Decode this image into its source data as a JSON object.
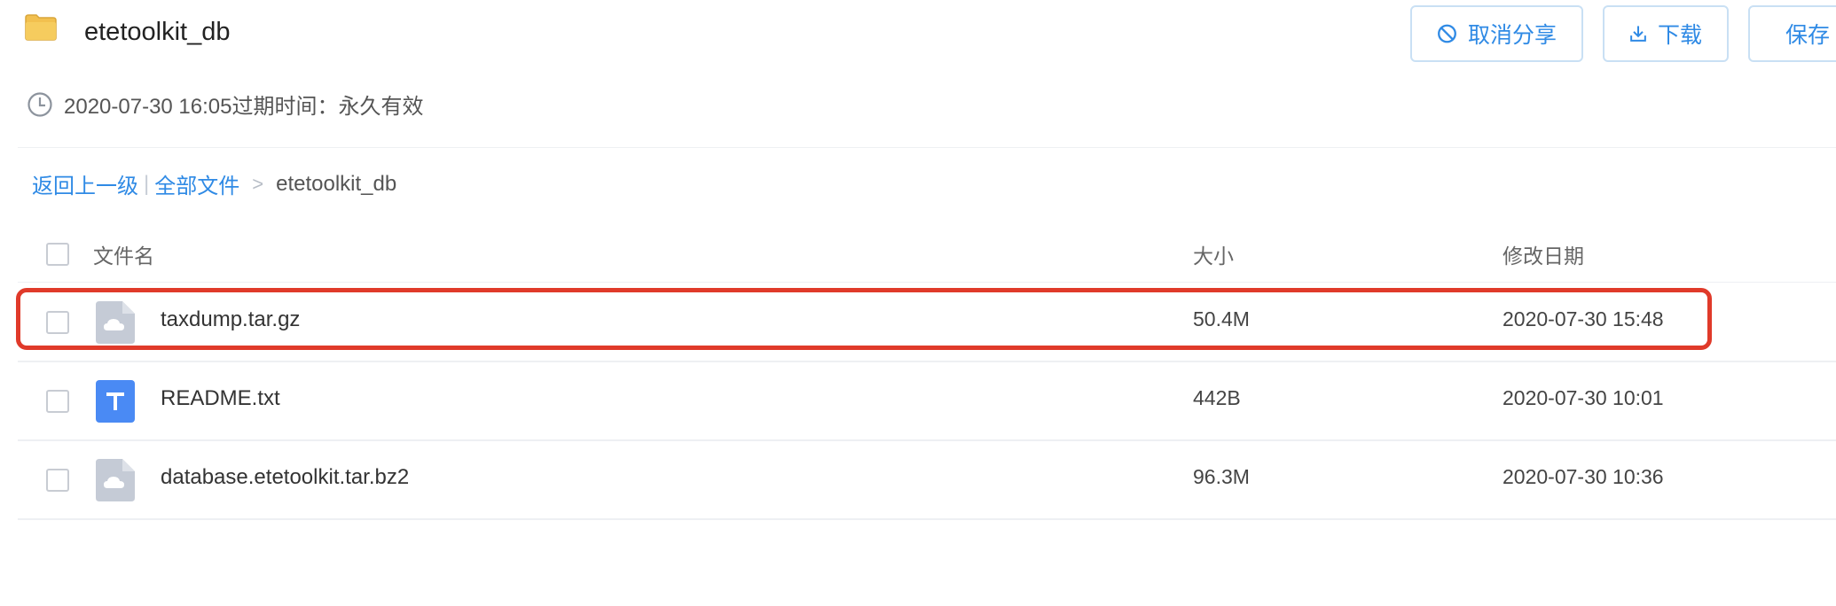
{
  "header": {
    "title": "etetoolkit_db",
    "folder_icon": "folder-icon"
  },
  "actions": {
    "cancel_share": "取消分享",
    "download": "下载",
    "save": "保存"
  },
  "meta": {
    "clock_icon": "clock-icon",
    "text": "2020-07-30 16:05过期时间：永久有效"
  },
  "breadcrumb": {
    "back": "返回上一级",
    "all_files": "全部文件",
    "separator": ">",
    "current": "etetoolkit_db"
  },
  "table": {
    "columns": {
      "name": "文件名",
      "size": "大小",
      "date": "修改日期"
    },
    "rows": [
      {
        "name": "taxdump.tar.gz",
        "size": "50.4M",
        "date": "2020-07-30 15:48",
        "icon": "cloud-file-icon",
        "highlighted": true
      },
      {
        "name": "README.txt",
        "size": "442B",
        "date": "2020-07-30 10:01",
        "icon": "text-file-icon"
      },
      {
        "name": "database.etetoolkit.tar.bz2",
        "size": "96.3M",
        "date": "2020-07-30 10:36",
        "icon": "cloud-file-icon"
      }
    ]
  },
  "colors": {
    "accent": "#2f8ae5",
    "highlight": "#e03a2a",
    "text_icon": "#4a8af4",
    "generic_icon": "#c5cbd6"
  }
}
